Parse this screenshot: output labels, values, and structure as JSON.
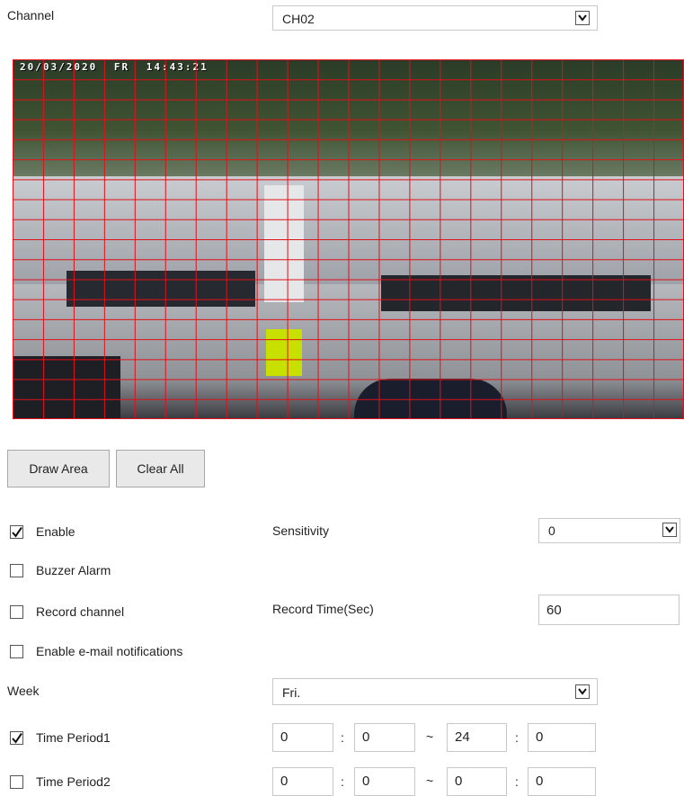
{
  "channel": {
    "label": "Channel",
    "value": "CH02"
  },
  "video": {
    "date": "20/03/2020",
    "weekday": "FR",
    "time": "14:43:21",
    "grid_color": "#e0111a"
  },
  "buttons": {
    "draw_area": "Draw Area",
    "clear_all": "Clear All"
  },
  "enable": {
    "label": "Enable",
    "checked": true
  },
  "sensitivity": {
    "label": "Sensitivity",
    "value": "0"
  },
  "buzzer_alarm": {
    "label": "Buzzer Alarm",
    "checked": false
  },
  "record_channel": {
    "label": "Record channel",
    "checked": false
  },
  "record_time": {
    "label": "Record Time(Sec)",
    "value": "60"
  },
  "email": {
    "label": "Enable e-mail notifications",
    "checked": false
  },
  "week": {
    "label": "Week",
    "value": "Fri."
  },
  "time_period1": {
    "label": "Time Period1",
    "checked": true,
    "start_hour": "0",
    "start_min": "0",
    "end_hour": "24",
    "end_min": "0"
  },
  "time_period2": {
    "label": "Time Period2",
    "checked": false,
    "start_hour": "0",
    "start_min": "0",
    "end_hour": "0",
    "end_min": "0"
  },
  "separators": {
    "colon": ":",
    "tilde": "~"
  },
  "icons": {
    "dropdown": "chevron-down-icon",
    "check": "checkmark-icon"
  }
}
